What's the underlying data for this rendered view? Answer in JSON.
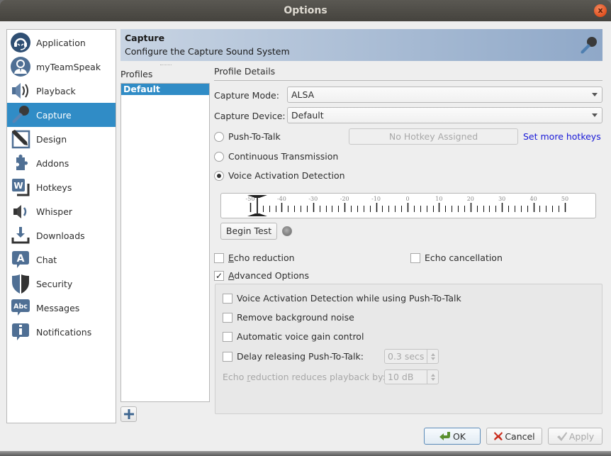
{
  "window": {
    "title": "Options",
    "close_label": "x"
  },
  "sidebar": {
    "items": [
      {
        "label": "Application",
        "icon": "headset-icon",
        "active": false
      },
      {
        "label": "myTeamSpeak",
        "icon": "user-avatar-icon",
        "active": false
      },
      {
        "label": "Playback",
        "icon": "speaker-icon",
        "active": false
      },
      {
        "label": "Capture",
        "icon": "microphone-icon",
        "active": true
      },
      {
        "label": "Design",
        "icon": "pencil-icon",
        "active": false
      },
      {
        "label": "Addons",
        "icon": "puzzle-icon",
        "active": false
      },
      {
        "label": "Hotkeys",
        "icon": "hotkey-w-icon",
        "active": false
      },
      {
        "label": "Whisper",
        "icon": "whisper-speaker-icon",
        "active": false
      },
      {
        "label": "Downloads",
        "icon": "download-icon",
        "active": false
      },
      {
        "label": "Chat",
        "icon": "chat-a-icon",
        "active": false
      },
      {
        "label": "Security",
        "icon": "shield-icon",
        "active": false
      },
      {
        "label": "Messages",
        "icon": "abc-bubble-icon",
        "active": false
      },
      {
        "label": "Notifications",
        "icon": "info-bubble-icon",
        "active": false
      }
    ]
  },
  "header": {
    "title": "Capture",
    "subtitle": "Configure the Capture Sound System",
    "icon": "microphone-icon"
  },
  "profiles": {
    "label": "Profiles",
    "items": [
      "Default"
    ],
    "selected": "Default",
    "add_icon": "plus-icon"
  },
  "details": {
    "label": "Profile Details",
    "capture_mode": {
      "label": "Capture Mode:",
      "value": "ALSA"
    },
    "capture_device": {
      "label": "Capture Device:",
      "value": "Default"
    },
    "modes": [
      {
        "label": "Push-To-Talk",
        "selected": false
      },
      {
        "label": "Continuous Transmission",
        "selected": false
      },
      {
        "label": "Voice Activation Detection",
        "selected": true
      }
    ],
    "hotkey_button": "No Hotkey Assigned",
    "set_hotkeys_link": "Set more hotkeys",
    "vad_meter": {
      "ticks": [
        "-50",
        "-40",
        "-30",
        "-20",
        "-10",
        "0",
        "10",
        "20",
        "30",
        "40",
        "50"
      ],
      "min": -50,
      "max": 50,
      "threshold": -50
    },
    "begin_test": "Begin Test",
    "echo_reduction": {
      "label_u": "E",
      "label_rest": "cho reduction",
      "checked": false
    },
    "echo_cancellation": {
      "label": "Echo cancellation",
      "checked": false
    },
    "advanced": {
      "label_u": "A",
      "label_rest": "dvanced Options",
      "checked": true
    },
    "advanced_options": [
      {
        "label": "Voice Activation Detection while using Push-To-Talk",
        "checked": false
      },
      {
        "label": "Remove background noise",
        "checked": false
      },
      {
        "label": "Automatic voice gain control",
        "checked": false
      },
      {
        "label": "Delay releasing Push-To-Talk:",
        "checked": false
      }
    ],
    "delay_value": "0.3 secs",
    "echo_reduce_label_a": "Echo ",
    "echo_reduce_label_u": "r",
    "echo_reduce_label_b": "eduction reduces playback by:",
    "echo_reduce_value": "10 dB"
  },
  "footer": {
    "ok": "OK",
    "cancel": "Cancel",
    "apply": "Apply"
  },
  "colors": {
    "accent": "#308cc6",
    "link": "#1a1ad8",
    "header_from": "#c8d4e3",
    "header_to": "#8fa8c8"
  }
}
